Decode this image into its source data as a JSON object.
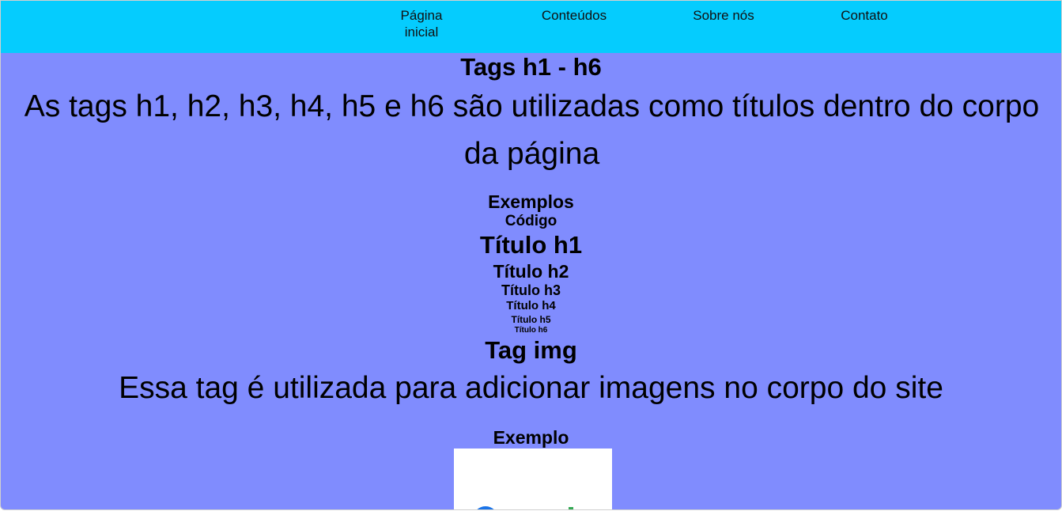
{
  "nav": {
    "items": [
      {
        "label": "Página inicial"
      },
      {
        "label": "Conteúdos"
      },
      {
        "label": "Sobre nós"
      },
      {
        "label": "Contato"
      }
    ]
  },
  "main": {
    "section_tags_title": "Tags h1 - h6",
    "section_tags_description": "As tags h1, h2, h3, h4, h5 e h6 são utilizadas como títulos dentro do corpo da página",
    "examples_heading": "Exemplos",
    "code_heading": "Código",
    "examples": {
      "h1": "Título h1",
      "h2": "Título h2",
      "h3": "Título h3",
      "h4": "Título h4",
      "h5": "Título h5",
      "h6": "Título h6"
    },
    "section_img_title": "Tag img",
    "section_img_description": "Essa tag é utilizada para adicionar imagens no corpo do site",
    "example_heading": "Exemplo"
  },
  "colors": {
    "nav_background": "#05ccfe",
    "page_background": "#808cfe",
    "image_background": "#ffffff"
  }
}
